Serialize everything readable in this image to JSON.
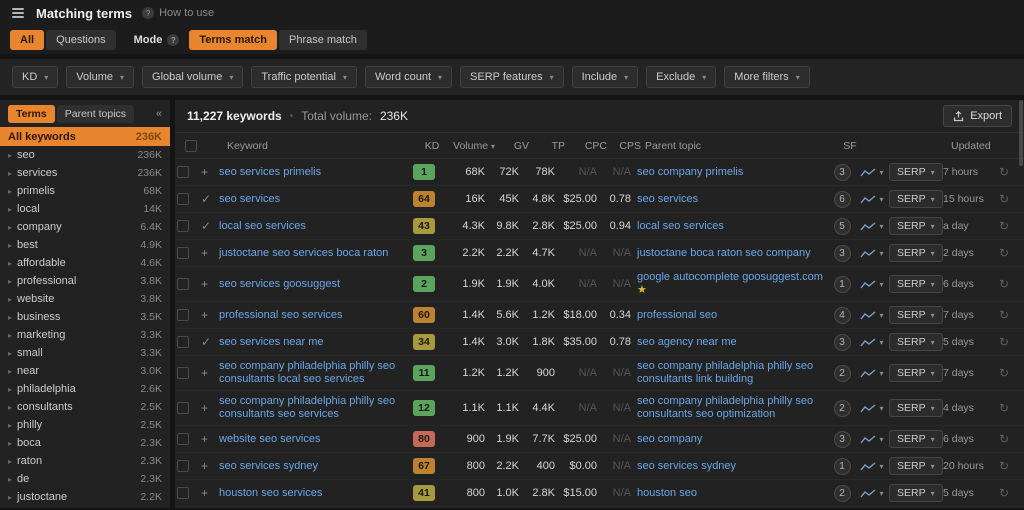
{
  "topbar": {
    "title": "Matching terms",
    "help": "How to use"
  },
  "tabs": {
    "all": "All",
    "questions": "Questions",
    "mode_label": "Mode",
    "terms_match": "Terms match",
    "phrase_match": "Phrase match"
  },
  "filters": {
    "items": [
      {
        "label": "KD"
      },
      {
        "label": "Volume"
      },
      {
        "label": "Global volume"
      },
      {
        "label": "Traffic potential"
      },
      {
        "label": "Word count"
      },
      {
        "label": "SERP features"
      },
      {
        "label": "Include"
      },
      {
        "label": "Exclude"
      },
      {
        "label": "More filters"
      }
    ]
  },
  "sidebar": {
    "tab_terms": "Terms",
    "tab_parent": "Parent topics",
    "all_keywords": "All keywords",
    "all_count": "236K",
    "items": [
      {
        "label": "seo",
        "count": "236K"
      },
      {
        "label": "services",
        "count": "236K"
      },
      {
        "label": "primelis",
        "count": "68K"
      },
      {
        "label": "local",
        "count": "14K"
      },
      {
        "label": "company",
        "count": "6.4K"
      },
      {
        "label": "best",
        "count": "4.9K"
      },
      {
        "label": "affordable",
        "count": "4.6K"
      },
      {
        "label": "professional",
        "count": "3.8K"
      },
      {
        "label": "website",
        "count": "3.8K"
      },
      {
        "label": "business",
        "count": "3.5K"
      },
      {
        "label": "marketing",
        "count": "3.3K"
      },
      {
        "label": "small",
        "count": "3.3K"
      },
      {
        "label": "near",
        "count": "3.0K"
      },
      {
        "label": "philadelphia",
        "count": "2.6K"
      },
      {
        "label": "consultants",
        "count": "2.5K"
      },
      {
        "label": "philly",
        "count": "2.5K"
      },
      {
        "label": "boca",
        "count": "2.3K"
      },
      {
        "label": "raton",
        "count": "2.3K"
      },
      {
        "label": "de",
        "count": "2.3K"
      },
      {
        "label": "justoctane",
        "count": "2.2K"
      }
    ]
  },
  "summary": {
    "keywords": "11,227 keywords",
    "total_label": "Total volume:",
    "total_value": "236K",
    "export": "Export"
  },
  "table": {
    "headers": {
      "keyword": "Keyword",
      "kd": "KD",
      "volume": "Volume",
      "gv": "GV",
      "tp": "TP",
      "cpc": "CPC",
      "cps": "CPS",
      "parent": "Parent topic",
      "sf": "SF",
      "updated": "Updated"
    },
    "serp_label": "SERP",
    "rows": [
      {
        "icon": "+",
        "keyword": "seo services primelis",
        "kd": "1",
        "kd_color": "green",
        "volume": "68K",
        "gv": "72K",
        "tp": "78K",
        "cpc": "N/A",
        "cps": "N/A",
        "parent": "seo company primelis",
        "sf": "3",
        "updated": "7 hours"
      },
      {
        "icon": "✓",
        "keyword": "seo services",
        "kd": "64",
        "kd_color": "orange",
        "volume": "16K",
        "gv": "45K",
        "tp": "4.8K",
        "cpc": "$25.00",
        "cps": "0.78",
        "parent": "seo services",
        "sf": "6",
        "updated": "15 hours"
      },
      {
        "icon": "✓",
        "keyword": "local seo services",
        "kd": "43",
        "kd_color": "yellow",
        "volume": "4.3K",
        "gv": "9.8K",
        "tp": "2.8K",
        "cpc": "$25.00",
        "cps": "0.94",
        "parent": "local seo services",
        "sf": "5",
        "updated": "a day"
      },
      {
        "icon": "+",
        "keyword": "justoctane seo services boca raton",
        "kd": "3",
        "kd_color": "green",
        "volume": "2.2K",
        "gv": "2.2K",
        "tp": "4.7K",
        "cpc": "N/A",
        "cps": "N/A",
        "parent": "justoctane boca raton seo company",
        "sf": "3",
        "updated": "2 days"
      },
      {
        "icon": "+",
        "keyword": "seo services goosuggest",
        "kd": "2",
        "kd_color": "green",
        "volume": "1.9K",
        "gv": "1.9K",
        "tp": "4.0K",
        "cpc": "N/A",
        "cps": "N/A",
        "parent": "google autocomplete goosuggest.com",
        "star": "★",
        "sf": "1",
        "updated": "6 days"
      },
      {
        "icon": "+",
        "keyword": "professional seo services",
        "kd": "60",
        "kd_color": "orange",
        "volume": "1.4K",
        "gv": "5.6K",
        "tp": "1.2K",
        "cpc": "$18.00",
        "cps": "0.34",
        "parent": "professional seo",
        "sf": "4",
        "updated": "7 days"
      },
      {
        "icon": "✓",
        "keyword": "seo services near me",
        "kd": "34",
        "kd_color": "yellow",
        "volume": "1.4K",
        "gv": "3.0K",
        "tp": "1.8K",
        "cpc": "$35.00",
        "cps": "0.78",
        "parent": "seo agency near me",
        "sf": "3",
        "updated": "5 days"
      },
      {
        "icon": "+",
        "keyword": "seo company philadelphia philly seo consultants local seo services",
        "kd": "11",
        "kd_color": "green",
        "volume": "1.2K",
        "gv": "1.2K",
        "tp": "900",
        "cpc": "N/A",
        "cps": "N/A",
        "parent": "seo company philadelphia philly seo consultants link building",
        "sf": "2",
        "updated": "7 days"
      },
      {
        "icon": "+",
        "keyword": "seo company philadelphia philly seo consultants seo services",
        "kd": "12",
        "kd_color": "green",
        "volume": "1.1K",
        "gv": "1.1K",
        "tp": "4.4K",
        "cpc": "N/A",
        "cps": "N/A",
        "parent": "seo company philadelphia philly seo consultants seo optimization",
        "sf": "2",
        "updated": "4 days"
      },
      {
        "icon": "+",
        "keyword": "website seo services",
        "kd": "80",
        "kd_color": "red",
        "volume": "900",
        "gv": "1.9K",
        "tp": "7.7K",
        "cpc": "$25.00",
        "cps": "N/A",
        "parent": "seo company",
        "sf": "3",
        "updated": "6 days"
      },
      {
        "icon": "+",
        "keyword": "seo services sydney",
        "kd": "67",
        "kd_color": "orange",
        "volume": "800",
        "gv": "2.2K",
        "tp": "400",
        "cpc": "$0.00",
        "cps": "N/A",
        "parent": "seo services sydney",
        "sf": "1",
        "updated": "20 hours"
      },
      {
        "icon": "+",
        "keyword": "houston seo services",
        "kd": "41",
        "kd_color": "yellow",
        "volume": "800",
        "gv": "1.0K",
        "tp": "2.8K",
        "cpc": "$15.00",
        "cps": "N/A",
        "parent": "houston seo",
        "sf": "2",
        "updated": "5 days"
      }
    ]
  }
}
